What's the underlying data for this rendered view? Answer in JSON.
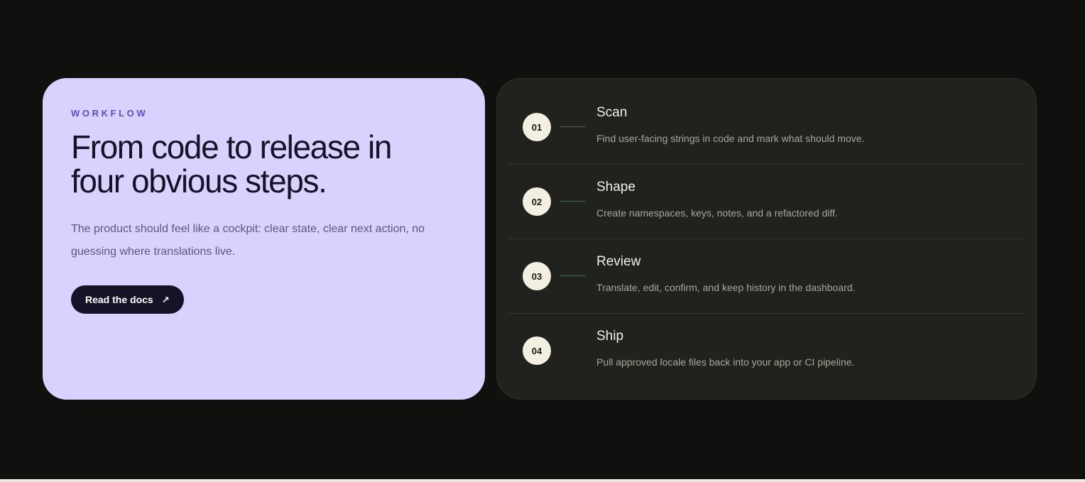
{
  "intro": {
    "eyebrow": "WORKFLOW",
    "headline": "From code to release in four obvious steps.",
    "lead": "The product should feel like a cockpit: clear state, clear next action, no guessing where translations live.",
    "button_label": "Read the docs",
    "button_icon": "arrow-up-right-icon"
  },
  "steps": [
    {
      "number": "01",
      "title": "Scan",
      "description": "Find user-facing strings in code and mark what should move.",
      "connector": true
    },
    {
      "number": "02",
      "title": "Shape",
      "description": "Create namespaces, keys, notes, and a refactored diff.",
      "connector": true
    },
    {
      "number": "03",
      "title": "Review",
      "description": "Translate, edit, confirm, and keep history in the dashboard.",
      "connector": true
    },
    {
      "number": "04",
      "title": "Ship",
      "description": "Pull approved locale files back into your app or CI pipeline.",
      "connector": false
    }
  ],
  "colors": {
    "page_background": "#10100e",
    "intro_card": "#d8d2fe",
    "eyebrow_accent": "#5b4cc0",
    "button": "#161329",
    "steps_card": "#21211d",
    "step_badge": "#f3efe2",
    "connector_line": "#3d6a55"
  }
}
